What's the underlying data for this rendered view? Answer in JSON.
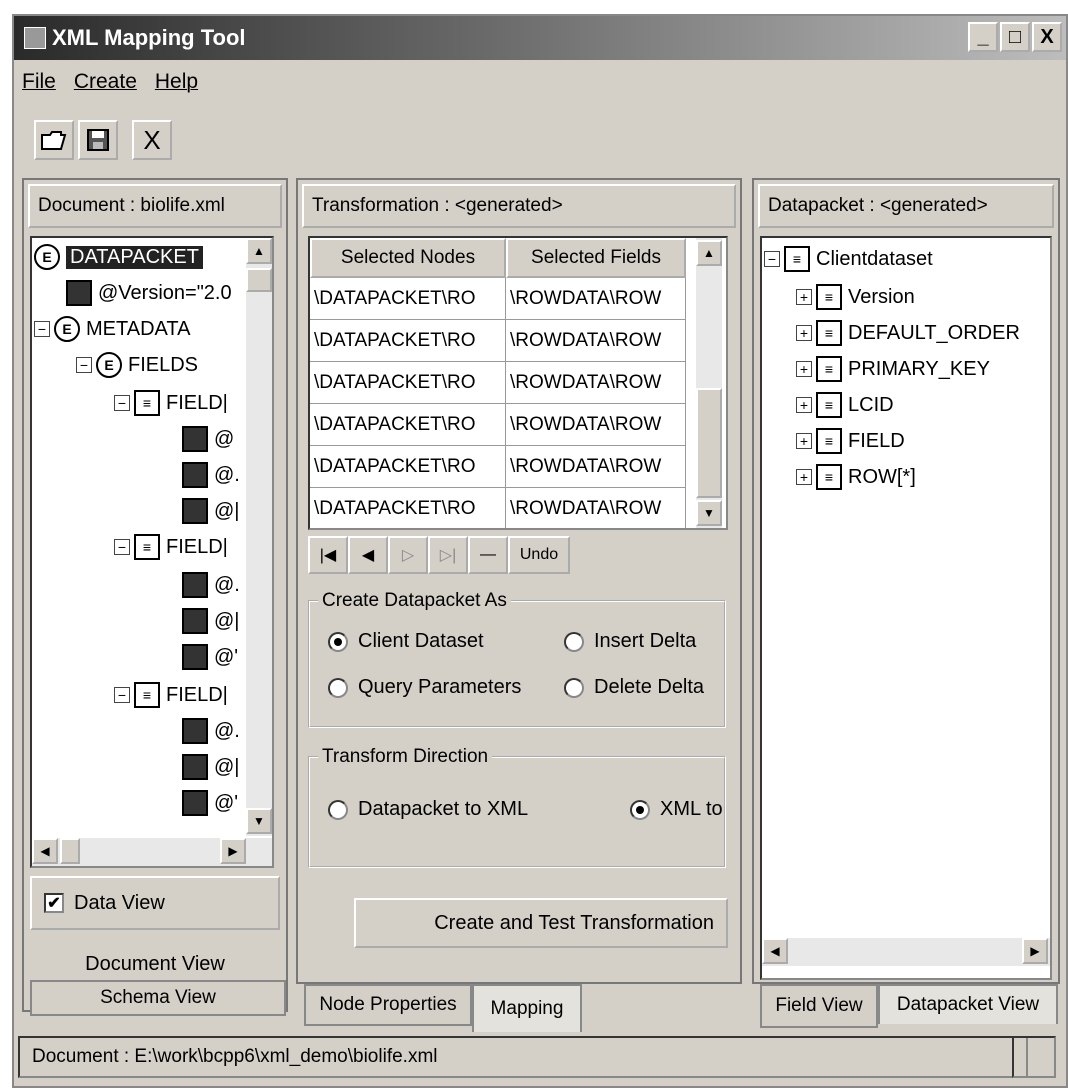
{
  "window": {
    "title": "XML Mapping Tool",
    "btn_min": "_",
    "btn_max": "□",
    "btn_close": "X"
  },
  "menu": {
    "file": "File",
    "create": "Create",
    "help": "Help"
  },
  "toolbar": {
    "open_icon": "open-folder-icon",
    "save_icon": "save-disk-icon",
    "close_icon": "close-x-icon",
    "close_glyph": "X"
  },
  "left_panel": {
    "header": "Document : biolife.xml",
    "tree": [
      {
        "label": "DATAPACKET",
        "icon": "element",
        "selected": true
      },
      {
        "label": "@Version=\"2.0",
        "icon": "attribute"
      },
      {
        "label": "METADATA",
        "icon": "element"
      },
      {
        "label": "FIELDS",
        "icon": "element"
      },
      {
        "label": "FIELD|",
        "icon": "node"
      },
      {
        "label": "@",
        "icon": "attribute"
      },
      {
        "label": "@.",
        "icon": "attribute"
      },
      {
        "label": "@|",
        "icon": "attribute"
      },
      {
        "label": "FIELD|",
        "icon": "node"
      },
      {
        "label": "@.",
        "icon": "attribute"
      },
      {
        "label": "@|",
        "icon": "attribute"
      },
      {
        "label": "@'",
        "icon": "attribute"
      },
      {
        "label": "FIELD|",
        "icon": "node"
      },
      {
        "label": "@.",
        "icon": "attribute"
      },
      {
        "label": "@|",
        "icon": "attribute"
      },
      {
        "label": "@'",
        "icon": "attribute"
      }
    ],
    "data_view_label": "Data View",
    "data_view_checked": true,
    "document_view_label": "Document View",
    "schema_view_tab": "Schema View"
  },
  "center_panel": {
    "header": "Transformation : <generated>",
    "col_nodes": "Selected Nodes",
    "col_fields": "Selected Fields",
    "rows": [
      {
        "node": "\\DATAPACKET\\RO",
        "field": "\\ROWDATA\\ROW"
      },
      {
        "node": "\\DATAPACKET\\RO",
        "field": "\\ROWDATA\\ROW"
      },
      {
        "node": "\\DATAPACKET\\RO",
        "field": "\\ROWDATA\\ROW"
      },
      {
        "node": "\\DATAPACKET\\RO",
        "field": "\\ROWDATA\\ROW"
      },
      {
        "node": "\\DATAPACKET\\RO",
        "field": "\\ROWDATA\\ROW"
      },
      {
        "node": "\\DATAPACKET\\RO",
        "field": "\\ROWDATA\\ROW"
      }
    ],
    "nav": {
      "first": "|◀",
      "prev": "◀",
      "next": "▷",
      "last": "▷|",
      "delete": "—",
      "undo": "Undo"
    },
    "create_group": {
      "label": "Create Datapacket As",
      "client_dataset": "Client Dataset",
      "insert_delta": "Insert Delta",
      "query_parameters": "Query Parameters",
      "delete_delta": "Delete Delta",
      "selected": "client_dataset"
    },
    "direction_group": {
      "label": "Transform Direction",
      "datapacket_to_xml": "Datapacket to XML",
      "xml_to": "XML to",
      "selected": "xml_to"
    },
    "create_button": "Create and Test Transformation",
    "tab_node_properties": "Node Properties",
    "tab_mapping": "Mapping"
  },
  "right_panel": {
    "header": "Datapacket : <generated>",
    "tree": [
      {
        "label": "Clientdataset",
        "level": 0
      },
      {
        "label": "Version",
        "level": 1
      },
      {
        "label": "DEFAULT_ORDER",
        "level": 1
      },
      {
        "label": "PRIMARY_KEY",
        "level": 1
      },
      {
        "label": "LCID",
        "level": 1
      },
      {
        "label": "FIELD",
        "level": 1
      },
      {
        "label": "ROW[*]",
        "level": 1
      }
    ],
    "tab_field_view": "Field View",
    "tab_datapacket_view": "Datapacket View"
  },
  "status": {
    "text": "Document : E:\\work\\bcpp6\\xml_demo\\biolife.xml"
  }
}
